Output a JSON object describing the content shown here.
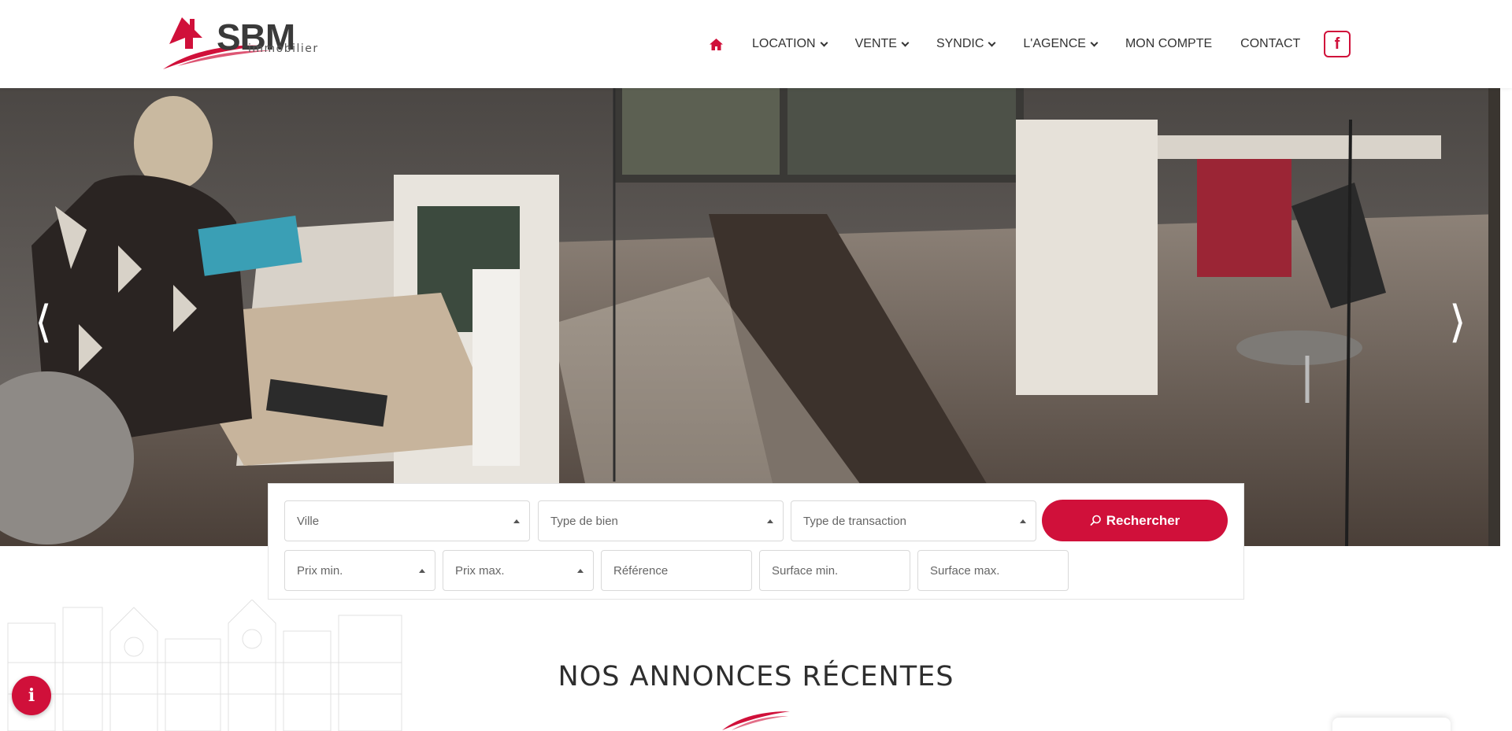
{
  "brand": {
    "name": "SBM",
    "tagline": "immobilier",
    "accent_color": "#d0103a"
  },
  "nav": {
    "home_icon": "home-icon",
    "items": [
      {
        "label": "LOCATION",
        "has_dropdown": true
      },
      {
        "label": "VENTE",
        "has_dropdown": true
      },
      {
        "label": "SYNDIC",
        "has_dropdown": true
      },
      {
        "label": "L'AGENCE",
        "has_dropdown": true
      },
      {
        "label": "MON COMPTE",
        "has_dropdown": false
      },
      {
        "label": "CONTACT",
        "has_dropdown": false
      }
    ],
    "social_icon": "facebook-icon",
    "social_label": "f"
  },
  "hero": {
    "prev_label": "⟨",
    "next_label": "⟩"
  },
  "search": {
    "ville": "Ville",
    "type_bien": "Type de bien",
    "type_transaction": "Type de transaction",
    "button_label": "Rechercher",
    "prix_min": "Prix min.",
    "prix_max": "Prix max.",
    "reference": "Référence",
    "surface_min": "Surface min.",
    "surface_max": "Surface max."
  },
  "section": {
    "title": "NOS ANNONCES RÉCENTES"
  },
  "info_button": {
    "label": "i"
  }
}
